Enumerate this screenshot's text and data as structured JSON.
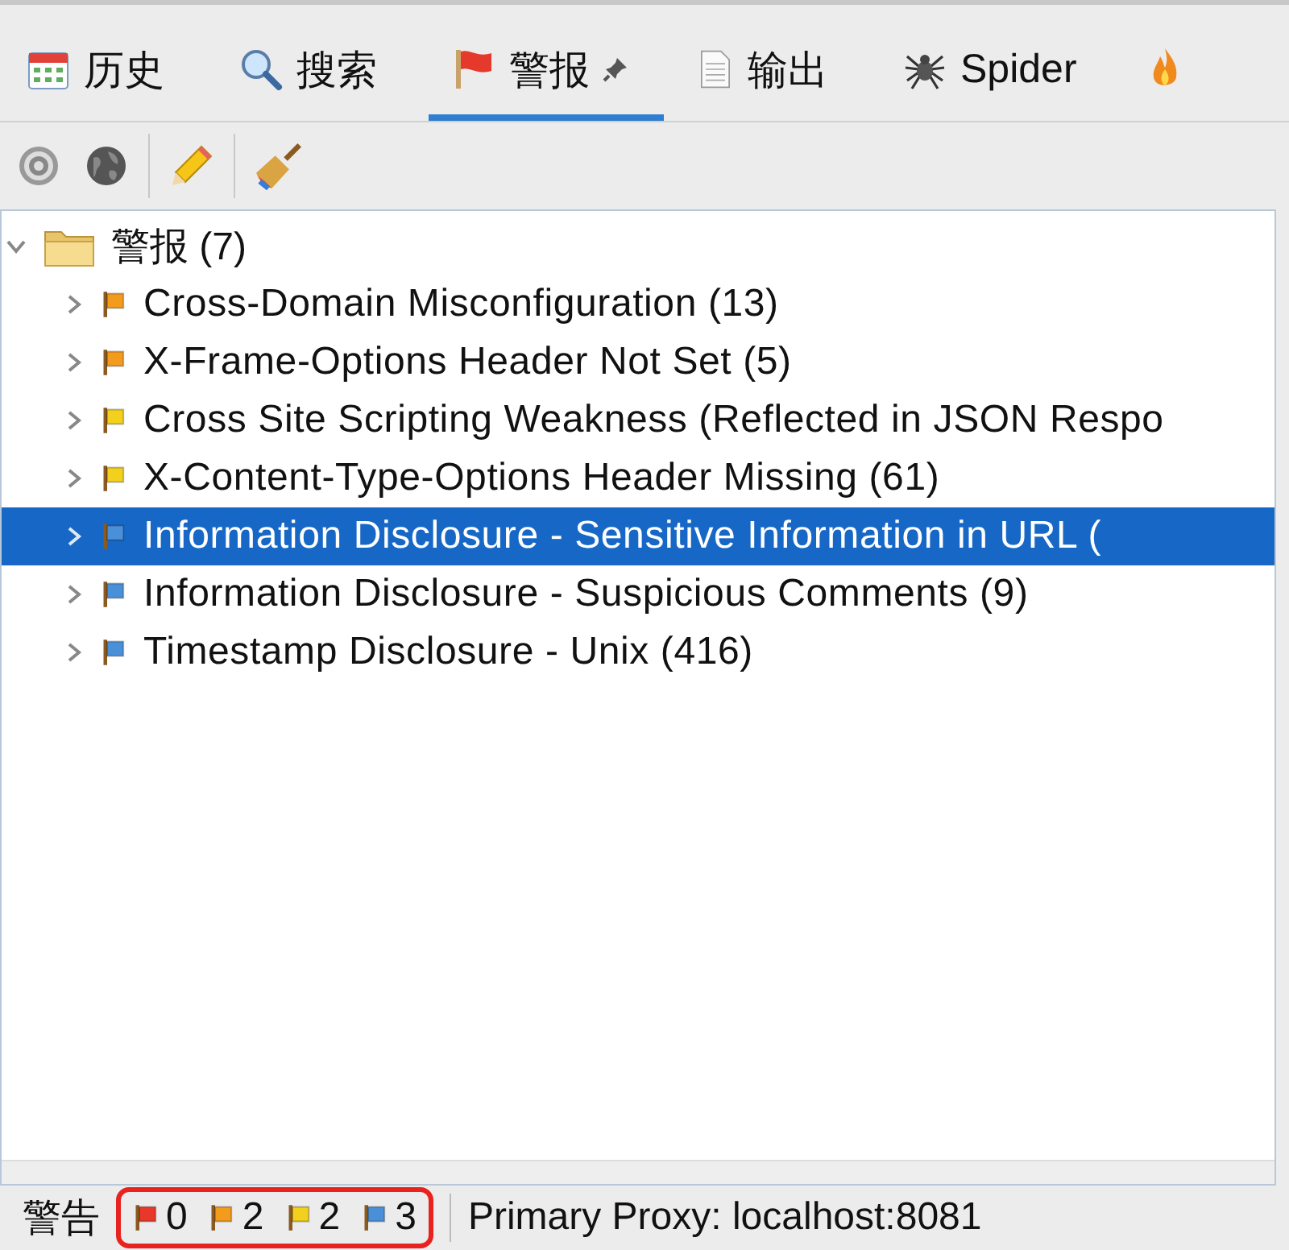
{
  "tabs": [
    {
      "label": "历史",
      "kind": "calendar",
      "selected": false,
      "pinned": false
    },
    {
      "label": "搜索",
      "kind": "search",
      "selected": false,
      "pinned": false
    },
    {
      "label": "警报",
      "kind": "flag",
      "selected": true,
      "pinned": true
    },
    {
      "label": "输出",
      "kind": "document",
      "selected": false,
      "pinned": false
    },
    {
      "label": "Spider",
      "kind": "spider",
      "selected": false,
      "pinned": false
    },
    {
      "kind": "flame",
      "selected": false,
      "pinned": false
    }
  ],
  "toolbar": [
    {
      "kind": "target"
    },
    {
      "kind": "globe"
    },
    {
      "kind": "separator"
    },
    {
      "kind": "pencil"
    },
    {
      "kind": "separator"
    },
    {
      "kind": "broom"
    }
  ],
  "tree": {
    "label": "警报 (7)",
    "expanded": true,
    "children": [
      {
        "label": "Cross-Domain Misconfiguration (13)",
        "color": "#f29b1d",
        "selected": false
      },
      {
        "label": "X-Frame-Options Header Not Set (5)",
        "color": "#f29b1d",
        "selected": false
      },
      {
        "label": "Cross Site Scripting Weakness (Reflected in JSON Respo",
        "color": "#f2d01d",
        "selected": false
      },
      {
        "label": "X-Content-Type-Options Header Missing (61)",
        "color": "#f2d01d",
        "selected": false
      },
      {
        "label": "Information Disclosure - Sensitive Information in URL (",
        "color": "#4a90d9",
        "selected": true
      },
      {
        "label": "Information Disclosure - Suspicious Comments (9)",
        "color": "#4a90d9",
        "selected": false
      },
      {
        "label": "Timestamp Disclosure - Unix (416)",
        "color": "#4a90d9",
        "selected": false
      }
    ]
  },
  "status_bar": {
    "label": "警告",
    "counts": [
      {
        "count": "0",
        "color": "#e8382a"
      },
      {
        "count": "2",
        "color": "#f29b1d"
      },
      {
        "count": "2",
        "color": "#f2d01d"
      },
      {
        "count": "3",
        "color": "#4a90d9"
      }
    ],
    "highlighted": true,
    "proxy": "Primary Proxy: localhost:8081"
  }
}
